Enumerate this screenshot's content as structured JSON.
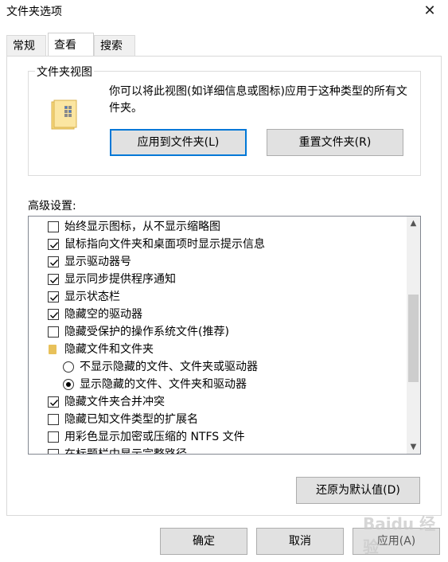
{
  "window": {
    "title": "文件夹选项",
    "close_glyph": "✕"
  },
  "tabs": [
    {
      "label": "常规"
    },
    {
      "label": "查看",
      "active": true
    },
    {
      "label": "搜索"
    }
  ],
  "folder_views": {
    "group_label": "文件夹视图",
    "description": "你可以将此视图(如详细信息或图标)应用于这种类型的所有文件夹。",
    "apply_button": "应用到文件夹(L)",
    "reset_button": "重置文件夹(R)"
  },
  "advanced": {
    "label": "高级设置:",
    "items": [
      {
        "type": "checkbox",
        "checked": false,
        "label": "始终显示图标，从不显示缩略图"
      },
      {
        "type": "checkbox",
        "checked": true,
        "label": "鼠标指向文件夹和桌面项时显示提示信息"
      },
      {
        "type": "checkbox",
        "checked": true,
        "label": "显示驱动器号"
      },
      {
        "type": "checkbox",
        "checked": true,
        "label": "显示同步提供程序通知"
      },
      {
        "type": "checkbox",
        "checked": true,
        "label": "显示状态栏"
      },
      {
        "type": "checkbox",
        "checked": true,
        "label": "隐藏空的驱动器"
      },
      {
        "type": "checkbox",
        "checked": false,
        "label": "隐藏受保护的操作系统文件(推荐)"
      },
      {
        "type": "folder",
        "label": "隐藏文件和文件夹"
      },
      {
        "type": "radio",
        "checked": false,
        "label": "不显示隐藏的文件、文件夹或驱动器"
      },
      {
        "type": "radio",
        "checked": true,
        "label": "显示隐藏的文件、文件夹和驱动器"
      },
      {
        "type": "checkbox",
        "checked": true,
        "label": "隐藏文件夹合并冲突"
      },
      {
        "type": "checkbox",
        "checked": false,
        "label": "隐藏已知文件类型的扩展名"
      },
      {
        "type": "checkbox",
        "checked": false,
        "label": "用彩色显示加密或压缩的 NTFS 文件"
      },
      {
        "type": "checkbox",
        "checked": false,
        "label": "在标题栏中显示完整路径"
      }
    ]
  },
  "restore_button": "还原为默认值(D)",
  "footer": {
    "ok": "确定",
    "cancel": "取消",
    "apply": "应用(A)"
  },
  "watermark": "Baidu 经验"
}
